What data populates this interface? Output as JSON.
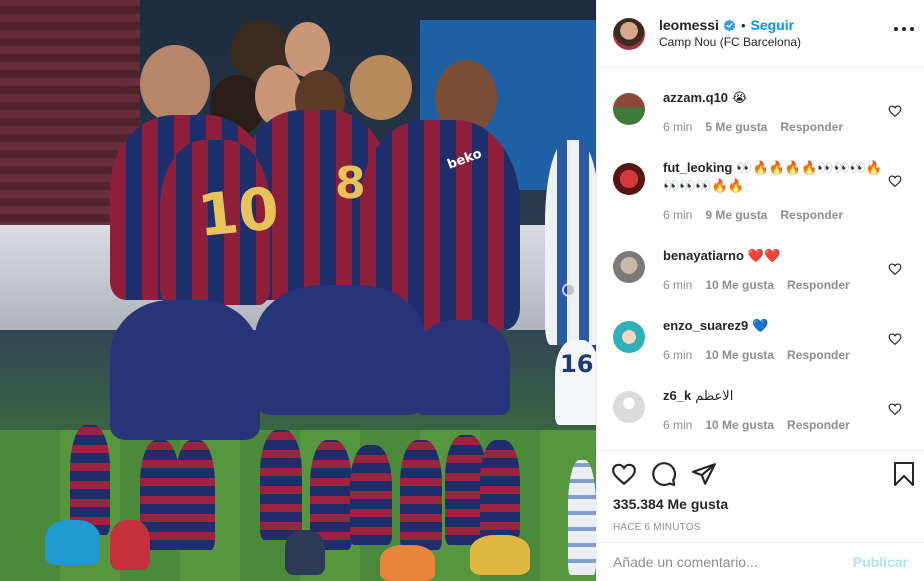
{
  "post": {
    "image_alt": "FC Barcelona players celebrating a goal",
    "jersey_numbers": [
      "10",
      "8"
    ],
    "away_number": "16",
    "sponsor": "beko"
  },
  "header": {
    "username": "leomessi",
    "separator": "•",
    "follow_label": "Seguir",
    "location": "Camp Nou (FC Barcelona)"
  },
  "comments": [
    {
      "user": "azzam.q10",
      "text": "😭",
      "time": "6 min",
      "likes": "5 Me gusta",
      "reply": "Responder"
    },
    {
      "user": "fut_leoking",
      "text": "👀🔥🔥🔥🔥👀👀👀🔥👀👀👀🔥🔥",
      "time": "6 min",
      "likes": "9 Me gusta",
      "reply": "Responder"
    },
    {
      "user": "benayatiarno",
      "text": "❤️❤️",
      "time": "6 min",
      "likes": "10 Me gusta",
      "reply": "Responder"
    },
    {
      "user": "enzo_suarez9",
      "text": "💙",
      "time": "6 min",
      "likes": "10 Me gusta",
      "reply": "Responder"
    },
    {
      "user": "z6_k",
      "text": "الاعظم",
      "time": "6 min",
      "likes": "10 Me gusta",
      "reply": "Responder"
    }
  ],
  "actions": {
    "likes_count": "335.384 Me gusta",
    "time_ago": "HACE 6 MINUTOS"
  },
  "composer": {
    "placeholder": "Añade un comentario...",
    "publish_label": "Publicar"
  },
  "colors": {
    "accent": "#0095f6",
    "publish_disabled": "#b2dffc",
    "muted": "#8e8e8e"
  }
}
